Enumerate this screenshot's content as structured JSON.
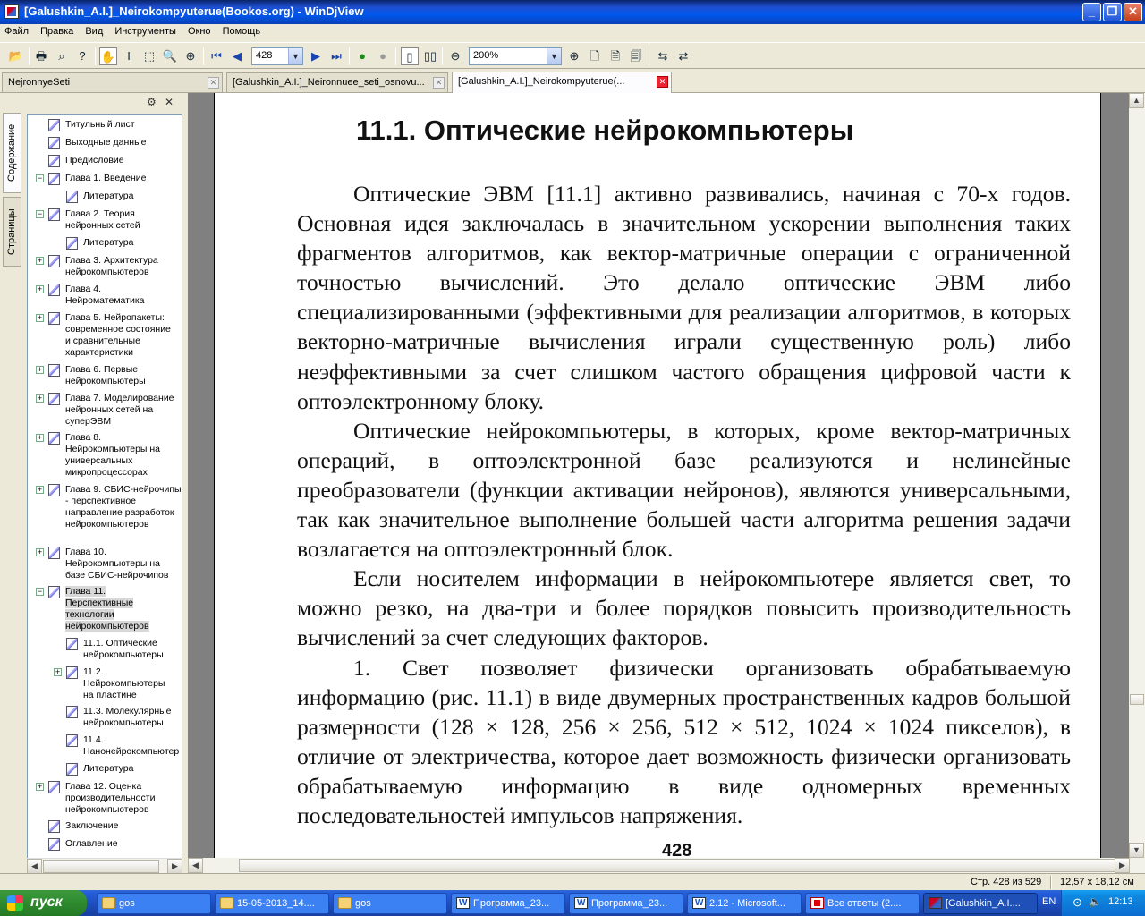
{
  "window": {
    "title": "[Galushkin_A.I.]_Neirokompyuterue(Bookos.org) - WinDjView",
    "buttons": {
      "minimize": "_",
      "maximize": "❐",
      "close": "✕"
    }
  },
  "menu": [
    "Файл",
    "Правка",
    "Вид",
    "Инструменты",
    "Окно",
    "Помощь"
  ],
  "toolbar": {
    "page_value": "428",
    "zoom_value": "200%"
  },
  "doc_tabs": [
    {
      "label": "NejronnyeSeti"
    },
    {
      "label": "[Galushkin_A.I.]_Neironnuee_seti_osnovu..."
    },
    {
      "label": "[Galushkin_A.I.]_Neirokompyuterue(..."
    }
  ],
  "side_tabs": {
    "contents": "Содержание",
    "pages": "Страницы"
  },
  "toc": [
    {
      "label": "Титульный лист"
    },
    {
      "label": "Выходные данные"
    },
    {
      "label": "Предисловие"
    },
    {
      "label": "Глава 1. Введение"
    },
    {
      "label": "Литература"
    },
    {
      "label": "Глава 2. Теория нейронных сетей"
    },
    {
      "label": "Литература"
    },
    {
      "label": "Глава 3. Архитектура нейрокомпьютеров"
    },
    {
      "label": "Глава 4. Нейроматематика"
    },
    {
      "label": "Глава 5. Нейропакеты: современное состояние и сравнительные характеристики"
    },
    {
      "label": "Глава 6. Первые нейрокомпьютеры"
    },
    {
      "label": "Глава 7. Моделирование нейронных сетей на суперЭВМ"
    },
    {
      "label": "Глава 8. Нейрокомпьютеры на универсальных микропроцессорах"
    },
    {
      "label": "Глава 9. СБИС-нейрочипы - перспективное направление разработок нейрокомпьютеров"
    },
    {
      "label": "Глава 10. Нейрокомпьютеры на базе СБИС-нейрочипов"
    },
    {
      "label": "Глава 11. Перспективные технологии нейрокомпьютеров"
    },
    {
      "label": "11.1. Оптические нейрокомпьютеры"
    },
    {
      "label": "11.2. Нейрокомпьютеры на пластине"
    },
    {
      "label": "11.3. Молекулярные нейрокомпьютеры"
    },
    {
      "label": "11.4. Нанонейрокомпьютер"
    },
    {
      "label": "Литература"
    },
    {
      "label": "Глава 12. Оценка производительности нейрокомпьютеров"
    },
    {
      "label": "Заключение"
    },
    {
      "label": "Оглавление"
    }
  ],
  "page": {
    "heading": "11.1. Оптические нейрокомпьютеры",
    "paragraphs": [
      "Оптические ЭВМ [11.1] активно развивались, начиная с 70-х годов. Основная идея заключалась в значительном ускорении выполнения таких фрагментов алгоритмов, как вектор-матричные операции с ограниченной точностью вычислений. Это делало оптические ЭВМ либо специализированными (эффективными для реализации алгоритмов, в которых векторно-матричные вычисления играли существенную роль) либо неэффективными за счет слишком частого обращения цифровой части к оптоэлектронному блоку.",
      "Оптические нейрокомпьютеры, в которых, кроме вектор-матричных операций, в оптоэлектронной базе реализуются и нелинейные преобразователи (функции активации нейронов), являются универсальными, так как значительное выполнение большей части алгоритма решения задачи возлагается на оптоэлектронный блок.",
      "Если носителем информации в нейрокомпьютере является свет, то можно резко, на два-три и более порядков повысить производительность вычислений за счет следующих факторов.",
      "1. Свет позволяет физически организовать обрабатываемую информацию (рис. 11.1) в виде двумерных пространственных кадров большой размерности (128 × 128, 256 × 256, 512 × 512, 1024 × 1024 пикселов), в отличие от электричества, которое дает возможность физически организовать обрабатываемую информацию в виде одномерных временных последовательностей импульсов напряжения."
    ],
    "page_number": "428"
  },
  "status": {
    "page_info": "Стр. 428 из 529",
    "size_info": "12,57 x 18,12 см"
  },
  "taskbar": {
    "start": "пуск",
    "tasks": [
      {
        "label": "gos",
        "icon": "folder"
      },
      {
        "label": "15-05-2013_14....",
        "icon": "folder"
      },
      {
        "label": "gos",
        "icon": "folder"
      },
      {
        "label": "Программа_23...",
        "icon": "word"
      },
      {
        "label": "Программа_23...",
        "icon": "word"
      },
      {
        "label": "2.12 - Microsoft...",
        "icon": "word"
      },
      {
        "label": "Все ответы (2....",
        "icon": "pdf"
      },
      {
        "label": "[Galushkin_A.I....",
        "icon": "djvu"
      }
    ],
    "lang": "EN",
    "clock": "12:13"
  }
}
